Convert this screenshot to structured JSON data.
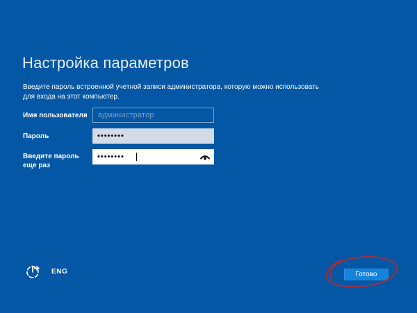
{
  "page": {
    "title": "Настройка параметров",
    "description": "Введите пароль встроенной учетной записи администратора, которую можно использовать\nдля входа на этот компьютер."
  },
  "form": {
    "username": {
      "label": "Имя пользователя",
      "placeholder": "администратор",
      "value": ""
    },
    "password": {
      "label": "Пароль",
      "value": "••••••••"
    },
    "confirm": {
      "label": "Введите пароль еще раз",
      "value": "••••••••"
    }
  },
  "footer": {
    "language_label": "ENG",
    "done_label": "Готово"
  },
  "icons": {
    "ease_of_access": "ease-of-access-icon",
    "reveal_password": "reveal-password-icon"
  },
  "colors": {
    "background": "#0357a4",
    "accent-button": "#1583dc",
    "field-filled": "#d3dbe6",
    "annotation": "#9b3040"
  }
}
